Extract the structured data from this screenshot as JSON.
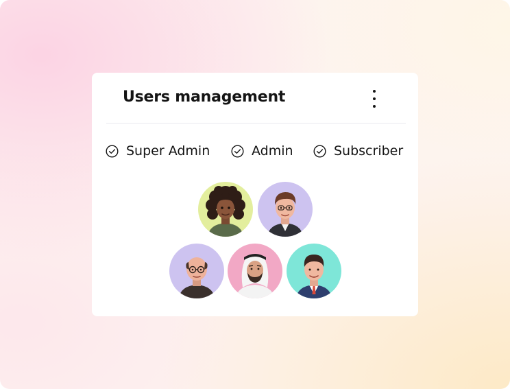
{
  "card": {
    "title": "Users management",
    "more_menu_icon": "vertical-dots-icon"
  },
  "roles": [
    {
      "label": "Super Admin",
      "icon": "check-circle-icon",
      "checked": true
    },
    {
      "label": "Admin",
      "icon": "check-circle-icon",
      "checked": true
    },
    {
      "label": "Subscriber",
      "icon": "check-circle-icon",
      "checked": true
    }
  ],
  "avatars": [
    {
      "bg": "#e3ee9d"
    },
    {
      "bg": "#cdc3f0"
    },
    {
      "bg": "#cdc3f0"
    },
    {
      "bg": "#f2a8c5"
    },
    {
      "bg": "#7ee6d8"
    }
  ],
  "colors": {
    "text": "#141414",
    "divider": "#e9e9ee",
    "card": "#ffffff"
  }
}
